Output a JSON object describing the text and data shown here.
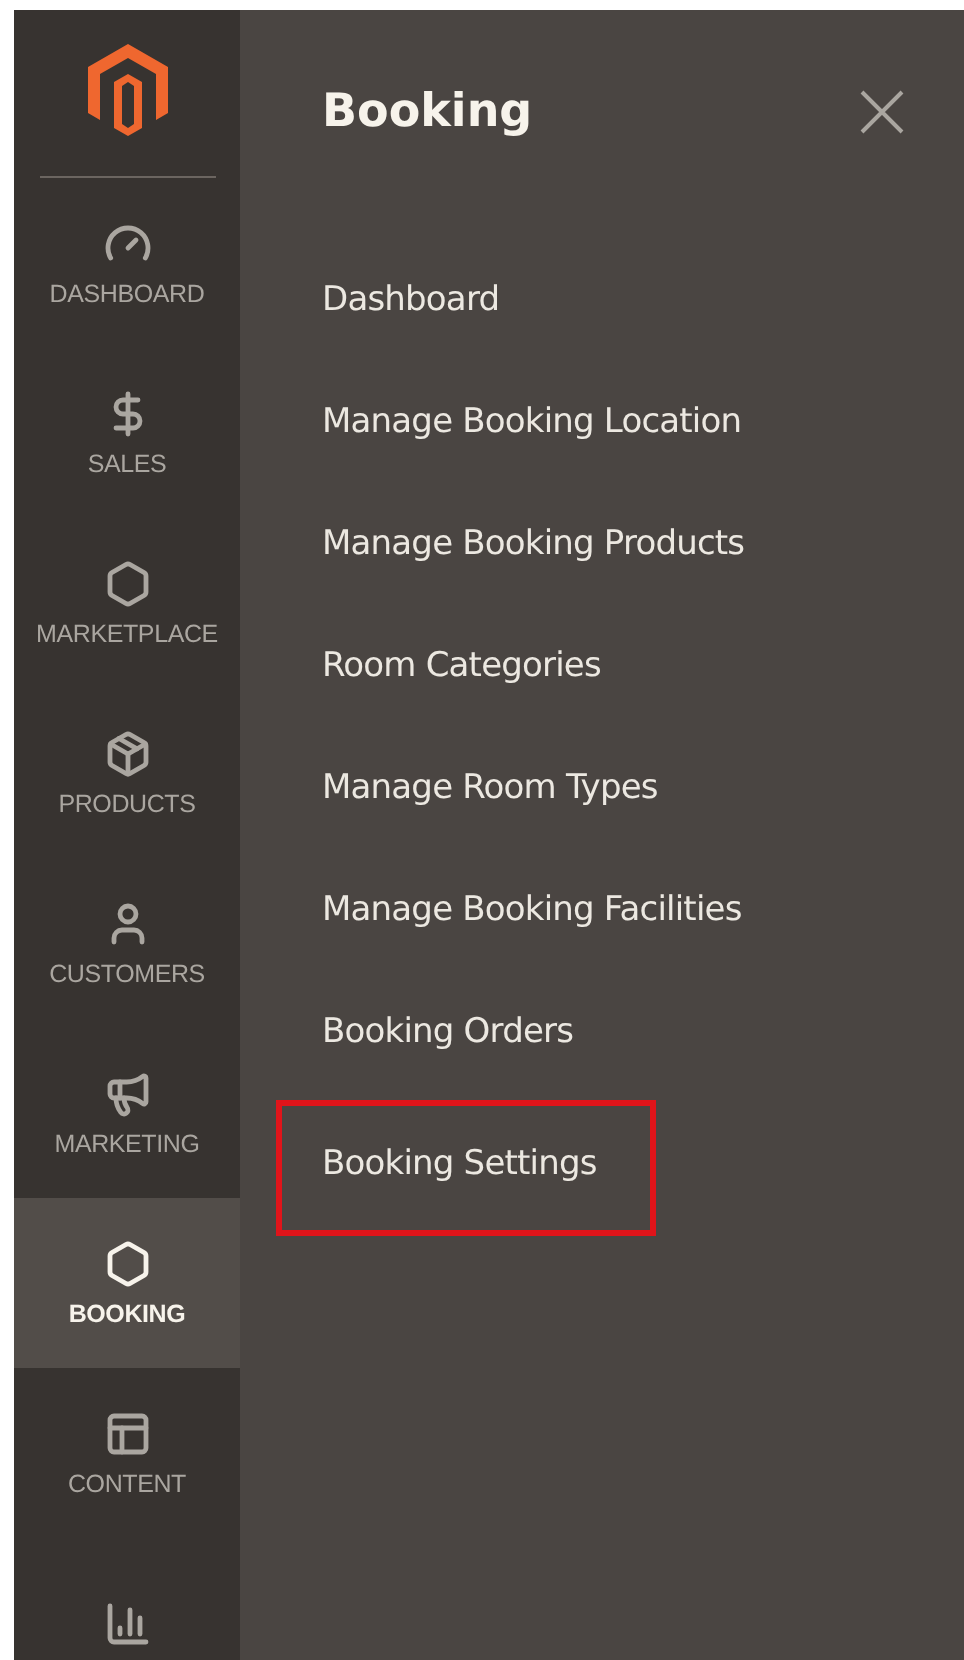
{
  "sidebar": {
    "items": [
      {
        "label": "DASHBOARD",
        "selected": false
      },
      {
        "label": "SALES",
        "selected": false
      },
      {
        "label": "MARKETPLACE",
        "selected": false
      },
      {
        "label": "PRODUCTS",
        "selected": false
      },
      {
        "label": "CUSTOMERS",
        "selected": false
      },
      {
        "label": "MARKETING",
        "selected": false
      },
      {
        "label": "BOOKING",
        "selected": true
      },
      {
        "label": "CONTENT",
        "selected": false
      },
      {
        "selected": false
      }
    ]
  },
  "panel": {
    "title": "Booking",
    "items": [
      {
        "label": "Dashboard",
        "highlighted": false
      },
      {
        "label": "Manage Booking Location",
        "highlighted": false
      },
      {
        "label": "Manage Booking Products",
        "highlighted": false
      },
      {
        "label": "Room Categories",
        "highlighted": false
      },
      {
        "label": "Manage Room Types",
        "highlighted": false
      },
      {
        "label": "Manage Booking Facilities",
        "highlighted": false
      },
      {
        "label": "Booking Orders",
        "highlighted": false
      },
      {
        "label": "Booking Settings",
        "highlighted": true
      }
    ]
  }
}
